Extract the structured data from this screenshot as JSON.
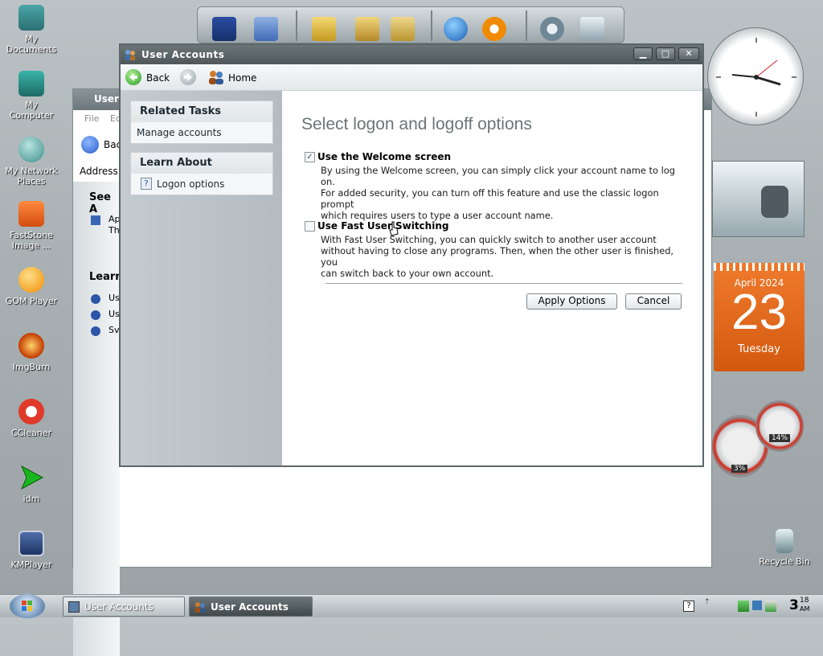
{
  "desktop": {
    "icons": [
      {
        "label": "My\nDocuments",
        "icon": "folder-documents-icon"
      },
      {
        "label": "My\nComputer",
        "icon": "computer-icon"
      },
      {
        "label": "My Network\nPlaces",
        "icon": "globe-network-icon"
      },
      {
        "label": "FastStone\nImage ...",
        "icon": "eye-icon"
      },
      {
        "label": "GOM Player",
        "icon": "gom-player-icon"
      },
      {
        "label": "ImgBurn",
        "icon": "fire-disc-icon"
      },
      {
        "label": "CCleaner",
        "icon": "ccleaner-icon"
      },
      {
        "label": "idm",
        "icon": "arrow-icon"
      },
      {
        "label": "KMPlayer",
        "icon": "kmplayer-icon"
      }
    ],
    "recycle_bin": "Recycle Bin"
  },
  "back_window": {
    "title": "User",
    "menu": [
      "File",
      "Ed"
    ],
    "back_label": "Bac",
    "address_label": "Address",
    "see_also": "See A",
    "see_items": [
      "Ap",
      "Th"
    ],
    "learn": "Learn",
    "learn_items": [
      "Us",
      "Us",
      "Sv"
    ]
  },
  "window": {
    "title": "User Accounts",
    "nav": {
      "back": "Back",
      "home": "Home"
    },
    "left_panel": {
      "related_tasks_header": "Related Tasks",
      "related_tasks_items": [
        "Manage accounts"
      ],
      "learn_about_header": "Learn About",
      "learn_about_items": [
        "Logon options"
      ]
    },
    "content": {
      "heading": "Select logon and logoff options",
      "option1": {
        "label": "Use the Welcome screen",
        "checked": true,
        "description_lines": [
          "By using the Welcome screen, you can simply click your account name to log on.",
          "For added security, you can turn off this feature and use the classic logon prompt",
          "which requires users to type a user account name."
        ]
      },
      "option2": {
        "label": "Use Fast User Switching",
        "checked": false,
        "description_lines": [
          "With Fast User Switching, you can quickly switch to another user account",
          "without having to close any programs. Then, when the other user is finished, you",
          "can switch back to your own account."
        ]
      },
      "apply_button": "Apply Options",
      "cancel_button": "Cancel"
    }
  },
  "gadgets": {
    "calendar": {
      "month_year": "April 2024",
      "day": "23",
      "weekday": "Tuesday"
    },
    "meters": {
      "cpu": "3%",
      "memory": "14%"
    }
  },
  "taskbar": {
    "buttons": [
      "User Accounts",
      "User Accounts"
    ],
    "clock_hour": "3",
    "clock_min": "18",
    "clock_ampm": "AM"
  },
  "colors": {
    "accent_orange": "#e8661c",
    "title_bar": "#5a6467"
  }
}
